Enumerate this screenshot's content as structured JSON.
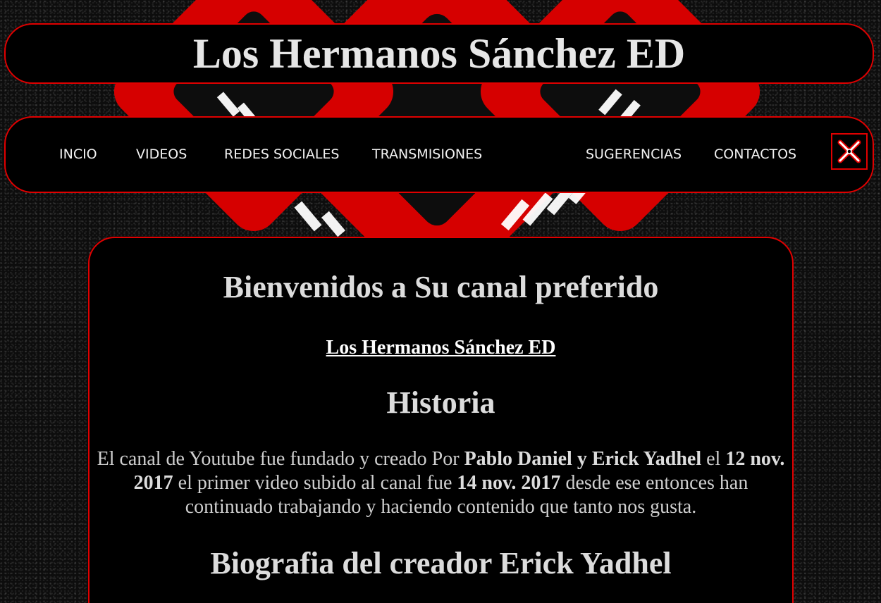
{
  "header": {
    "title": "Los Hermanos Sánchez ED"
  },
  "nav": {
    "items": [
      {
        "label": "INCIO"
      },
      {
        "label": "VIDEOS"
      },
      {
        "label": "REDES SOCIALES"
      },
      {
        "label": "TRANSMISIONES"
      },
      {
        "label": "SUGERENCIAS"
      },
      {
        "label": "CONTACTOS"
      }
    ],
    "close_icon": "close-x-icon"
  },
  "main": {
    "welcome": "Bienvenidos a Su canal preferido",
    "channel_link": "Los Hermanos Sánchez ED",
    "historia": {
      "heading": "Historia",
      "text_1": "El canal de Youtube fue fundado y creado Por ",
      "founders": "Pablo Daniel y Erick Yadhel",
      "text_2": " el ",
      "founded_date": "12 nov. 2017",
      "text_3": " el primer video subido al canal fue ",
      "first_video_date": "14 nov. 2017",
      "text_4": " desde ese entonces han continuado trabajando y haciendo contenido que tanto nos gusta."
    },
    "bio_heading": "Biografia del creador Erick Yadhel"
  },
  "colors": {
    "accent": "#e00000",
    "panel": "#000000",
    "text": "#dcdcdc"
  }
}
